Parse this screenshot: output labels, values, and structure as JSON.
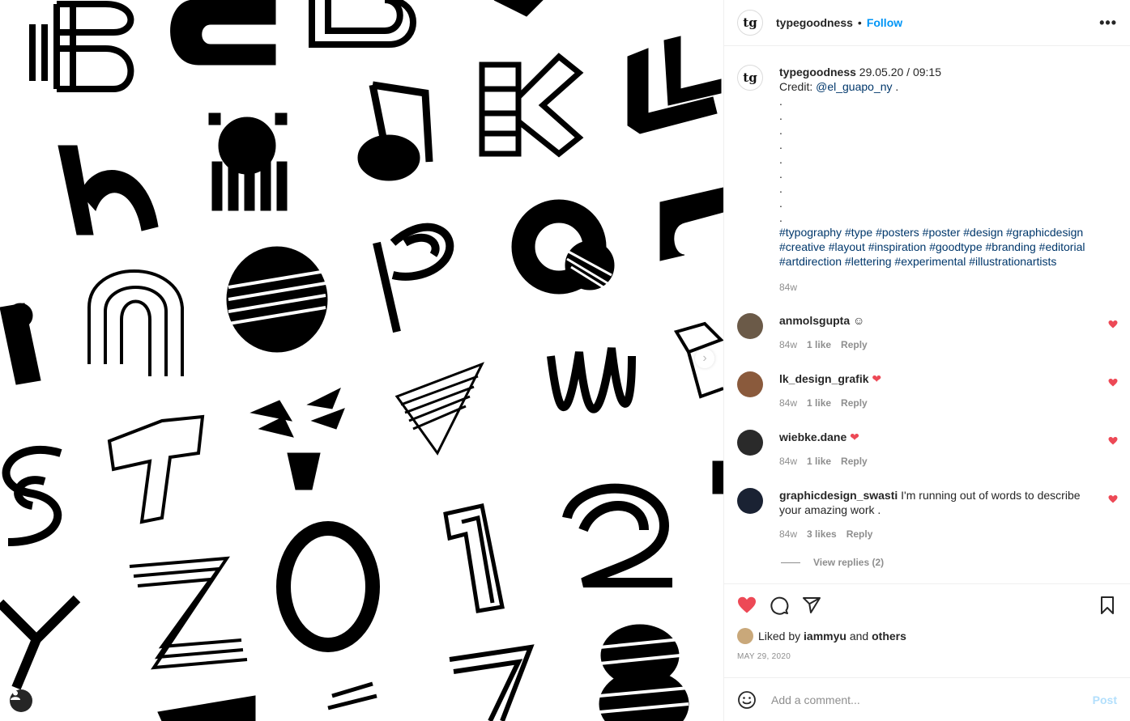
{
  "header": {
    "username": "typegoodness",
    "separator": "•",
    "follow_label": "Follow",
    "more_icon": "more-horizontal-icon",
    "avatar_text": "tg"
  },
  "caption": {
    "username": "typegoodness",
    "text": "29.05.20 / 09:15",
    "credit_label": "Credit:",
    "credit_handle": "@el_guapo_ny",
    "credit_suffix": ".",
    "dots": [
      ".",
      ".",
      ".",
      ".",
      ".",
      ".",
      ".",
      ".",
      "."
    ],
    "hashtags_line1": "#typography #type #posters #poster #design #graphicdesign",
    "hashtags_line2": "#creative #layout #inspiration #goodtype #branding #editorial",
    "hashtags_line3": "#artdirection #lettering #experimental #illustrationartists",
    "time": "84w"
  },
  "comments": [
    {
      "username": "anmolsgupta",
      "text": "☺",
      "time": "84w",
      "likes": "1 like",
      "reply": "Reply",
      "avatar_color": "#6b5a48"
    },
    {
      "username": "lk_design_grafik",
      "text": "❤",
      "time": "84w",
      "likes": "1 like",
      "reply": "Reply",
      "avatar_color": "#8a5a3c"
    },
    {
      "username": "wiebke.dane",
      "text": "❤",
      "time": "84w",
      "likes": "1 like",
      "reply": "Reply",
      "avatar_color": "#2a2a2a"
    },
    {
      "username": "graphicdesign_swasti",
      "text": "I'm running out of words to describe your amazing work .",
      "time": "84w",
      "likes": "3 likes",
      "reply": "Reply",
      "avatar_color": "#1a2233"
    }
  ],
  "view_replies": "View replies (2)",
  "liked": {
    "prefix": "Liked by",
    "user": "iammyu",
    "and": "and",
    "others": "others"
  },
  "date": "MAY 29, 2020",
  "add_comment": {
    "placeholder": "Add a comment...",
    "post_label": "Post"
  },
  "colors": {
    "like_red": "#ed4956",
    "link_blue": "#00376b",
    "follow_blue": "#0095f6"
  }
}
